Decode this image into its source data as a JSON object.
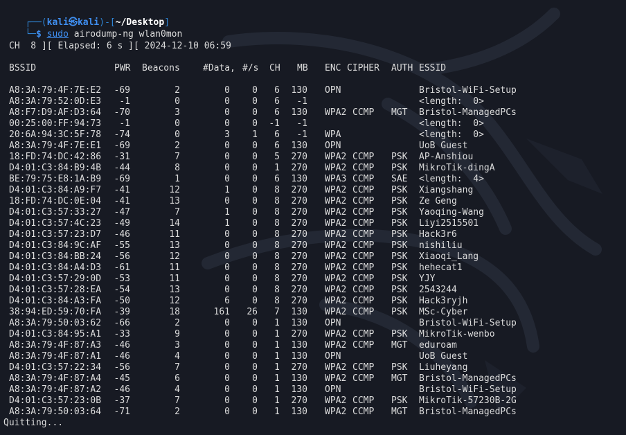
{
  "prompt": {
    "corner_top": "┌──(",
    "user": "kali",
    "at_symbol": "㉿",
    "host": "kali",
    "sep": ")-[",
    "path": "~/Desktop",
    "close": "]",
    "corner_bottom": "└─",
    "dollar": "$",
    "cmd_sudo": "sudo",
    "cmd_rest": "airodump-ng wlan0mon"
  },
  "status_line": "CH  8 ][ Elapsed: 6 s ][ 2024-12-10 06:59",
  "headers": {
    "bssid": "BSSID",
    "pwr": "PWR",
    "beacons": "Beacons",
    "data": "#Data,",
    "rate": "#/s",
    "ch": "CH",
    "mb": "MB",
    "enc": "ENC",
    "cipher": "CIPHER",
    "auth": "AUTH",
    "essid": "ESSID"
  },
  "rows": [
    {
      "bssid": "A8:3A:79:4F:7E:E2",
      "pwr": "-69",
      "beacons": "2",
      "data": "0",
      "rate": "0",
      "ch": "6",
      "mb": "130",
      "enc": "OPN",
      "cipher": "",
      "auth": "",
      "essid": "Bristol-WiFi-Setup"
    },
    {
      "bssid": "A8:3A:79:52:0D:E3",
      "pwr": "-1",
      "beacons": "0",
      "data": "0",
      "rate": "0",
      "ch": "6",
      "mb": "-1",
      "enc": "",
      "cipher": "",
      "auth": "",
      "essid": "<length:  0>"
    },
    {
      "bssid": "A8:F7:D9:AF:D3:64",
      "pwr": "-70",
      "beacons": "3",
      "data": "0",
      "rate": "0",
      "ch": "6",
      "mb": "130",
      "enc": "WPA2",
      "cipher": "CCMP",
      "auth": "MGT",
      "essid": "Bristol-ManagedPCs"
    },
    {
      "bssid": "00:25:00:FF:94:73",
      "pwr": "-1",
      "beacons": "0",
      "data": "0",
      "rate": "0",
      "ch": "-1",
      "mb": "-1",
      "enc": "",
      "cipher": "",
      "auth": "",
      "essid": "<length:  0>"
    },
    {
      "bssid": "20:6A:94:3C:5F:78",
      "pwr": "-74",
      "beacons": "0",
      "data": "3",
      "rate": "1",
      "ch": "6",
      "mb": "-1",
      "enc": "WPA",
      "cipher": "",
      "auth": "",
      "essid": "<length:  0>"
    },
    {
      "bssid": "A8:3A:79:4F:7E:E1",
      "pwr": "-69",
      "beacons": "2",
      "data": "0",
      "rate": "0",
      "ch": "6",
      "mb": "130",
      "enc": "OPN",
      "cipher": "",
      "auth": "",
      "essid": "UoB Guest"
    },
    {
      "bssid": "18:FD:74:DC:42:86",
      "pwr": "-31",
      "beacons": "7",
      "data": "0",
      "rate": "0",
      "ch": "5",
      "mb": "270",
      "enc": "WPA2",
      "cipher": "CCMP",
      "auth": "PSK",
      "essid": "AP-Anshiou"
    },
    {
      "bssid": "D4:01:C3:84:B9:4B",
      "pwr": "-44",
      "beacons": "8",
      "data": "0",
      "rate": "0",
      "ch": "1",
      "mb": "270",
      "enc": "WPA2",
      "cipher": "CCMP",
      "auth": "PSK",
      "essid": "MikroTik-dingA"
    },
    {
      "bssid": "BE:79:75:E8:1A:B9",
      "pwr": "-69",
      "beacons": "1",
      "data": "0",
      "rate": "0",
      "ch": "6",
      "mb": "130",
      "enc": "WPA3",
      "cipher": "CCMP",
      "auth": "SAE",
      "essid": "<length:  4>"
    },
    {
      "bssid": "D4:01:C3:84:A9:F7",
      "pwr": "-41",
      "beacons": "12",
      "data": "1",
      "rate": "0",
      "ch": "8",
      "mb": "270",
      "enc": "WPA2",
      "cipher": "CCMP",
      "auth": "PSK",
      "essid": "Xiangshang"
    },
    {
      "bssid": "18:FD:74:DC:0E:04",
      "pwr": "-41",
      "beacons": "13",
      "data": "0",
      "rate": "0",
      "ch": "8",
      "mb": "270",
      "enc": "WPA2",
      "cipher": "CCMP",
      "auth": "PSK",
      "essid": "Ze Geng"
    },
    {
      "bssid": "D4:01:C3:57:33:27",
      "pwr": "-47",
      "beacons": "7",
      "data": "1",
      "rate": "0",
      "ch": "8",
      "mb": "270",
      "enc": "WPA2",
      "cipher": "CCMP",
      "auth": "PSK",
      "essid": "Yaoqing-Wang"
    },
    {
      "bssid": "D4:01:C3:57:4C:23",
      "pwr": "-49",
      "beacons": "14",
      "data": "1",
      "rate": "0",
      "ch": "8",
      "mb": "270",
      "enc": "WPA2",
      "cipher": "CCMP",
      "auth": "PSK",
      "essid": "Liyi2515501"
    },
    {
      "bssid": "D4:01:C3:57:23:D7",
      "pwr": "-46",
      "beacons": "11",
      "data": "0",
      "rate": "0",
      "ch": "8",
      "mb": "270",
      "enc": "WPA2",
      "cipher": "CCMP",
      "auth": "PSK",
      "essid": "Hack3r6"
    },
    {
      "bssid": "D4:01:C3:84:9C:AF",
      "pwr": "-55",
      "beacons": "13",
      "data": "0",
      "rate": "0",
      "ch": "8",
      "mb": "270",
      "enc": "WPA2",
      "cipher": "CCMP",
      "auth": "PSK",
      "essid": "nishiliu"
    },
    {
      "bssid": "D4:01:C3:84:BB:24",
      "pwr": "-56",
      "beacons": "12",
      "data": "0",
      "rate": "0",
      "ch": "8",
      "mb": "270",
      "enc": "WPA2",
      "cipher": "CCMP",
      "auth": "PSK",
      "essid": "Xiaoqi_Lang"
    },
    {
      "bssid": "D4:01:C3:84:A4:D3",
      "pwr": "-61",
      "beacons": "11",
      "data": "0",
      "rate": "0",
      "ch": "8",
      "mb": "270",
      "enc": "WPA2",
      "cipher": "CCMP",
      "auth": "PSK",
      "essid": "hehecat1"
    },
    {
      "bssid": "D4:01:C3:57:29:0D",
      "pwr": "-53",
      "beacons": "11",
      "data": "0",
      "rate": "0",
      "ch": "8",
      "mb": "270",
      "enc": "WPA2",
      "cipher": "CCMP",
      "auth": "PSK",
      "essid": "YJY"
    },
    {
      "bssid": "D4:01:C3:57:28:EA",
      "pwr": "-54",
      "beacons": "13",
      "data": "0",
      "rate": "0",
      "ch": "8",
      "mb": "270",
      "enc": "WPA2",
      "cipher": "CCMP",
      "auth": "PSK",
      "essid": "2543244"
    },
    {
      "bssid": "D4:01:C3:84:A3:FA",
      "pwr": "-50",
      "beacons": "12",
      "data": "6",
      "rate": "0",
      "ch": "8",
      "mb": "270",
      "enc": "WPA2",
      "cipher": "CCMP",
      "auth": "PSK",
      "essid": "Hack3ryjh"
    },
    {
      "bssid": "38:94:ED:59:70:FA",
      "pwr": "-39",
      "beacons": "18",
      "data": "161",
      "rate": "26",
      "ch": "7",
      "mb": "130",
      "enc": "WPA2",
      "cipher": "CCMP",
      "auth": "PSK",
      "essid": "MSc-Cyber"
    },
    {
      "bssid": "A8:3A:79:50:03:62",
      "pwr": "-66",
      "beacons": "2",
      "data": "0",
      "rate": "0",
      "ch": "1",
      "mb": "130",
      "enc": "OPN",
      "cipher": "",
      "auth": "",
      "essid": "Bristol-WiFi-Setup"
    },
    {
      "bssid": "D4:01:C3:84:95:A1",
      "pwr": "-33",
      "beacons": "9",
      "data": "0",
      "rate": "0",
      "ch": "1",
      "mb": "270",
      "enc": "WPA2",
      "cipher": "CCMP",
      "auth": "PSK",
      "essid": "MikroTik-wenbo"
    },
    {
      "bssid": "A8:3A:79:4F:87:A3",
      "pwr": "-46",
      "beacons": "3",
      "data": "0",
      "rate": "0",
      "ch": "1",
      "mb": "130",
      "enc": "WPA2",
      "cipher": "CCMP",
      "auth": "MGT",
      "essid": "eduroam"
    },
    {
      "bssid": "A8:3A:79:4F:87:A1",
      "pwr": "-46",
      "beacons": "4",
      "data": "0",
      "rate": "0",
      "ch": "1",
      "mb": "130",
      "enc": "OPN",
      "cipher": "",
      "auth": "",
      "essid": "UoB Guest"
    },
    {
      "bssid": "D4:01:C3:57:22:34",
      "pwr": "-56",
      "beacons": "7",
      "data": "0",
      "rate": "0",
      "ch": "1",
      "mb": "270",
      "enc": "WPA2",
      "cipher": "CCMP",
      "auth": "PSK",
      "essid": "Liuheyang"
    },
    {
      "bssid": "A8:3A:79:4F:87:A4",
      "pwr": "-45",
      "beacons": "6",
      "data": "0",
      "rate": "0",
      "ch": "1",
      "mb": "130",
      "enc": "WPA2",
      "cipher": "CCMP",
      "auth": "MGT",
      "essid": "Bristol-ManagedPCs"
    },
    {
      "bssid": "A8:3A:79:4F:87:A2",
      "pwr": "-46",
      "beacons": "4",
      "data": "0",
      "rate": "0",
      "ch": "1",
      "mb": "130",
      "enc": "OPN",
      "cipher": "",
      "auth": "",
      "essid": "Bristol-WiFi-Setup"
    },
    {
      "bssid": "D4:01:C3:57:23:0B",
      "pwr": "-37",
      "beacons": "7",
      "data": "0",
      "rate": "0",
      "ch": "1",
      "mb": "270",
      "enc": "WPA2",
      "cipher": "CCMP",
      "auth": "PSK",
      "essid": "MikroTik-57230B-2G"
    },
    {
      "bssid": "A8:3A:79:50:03:64",
      "pwr": "-71",
      "beacons": "2",
      "data": "0",
      "rate": "0",
      "ch": "1",
      "mb": "130",
      "enc": "WPA2",
      "cipher": "CCMP",
      "auth": "MGT",
      "essid": "Bristol-ManagedPCs"
    }
  ],
  "footer": "Quitting...",
  "colors": {
    "background": "#171a23",
    "text": "#dcdcdc",
    "prompt_frame": "#2f86d6",
    "prompt_user": "#3f8ef0"
  },
  "icons": {
    "background": "kali-dragon-watermark"
  }
}
